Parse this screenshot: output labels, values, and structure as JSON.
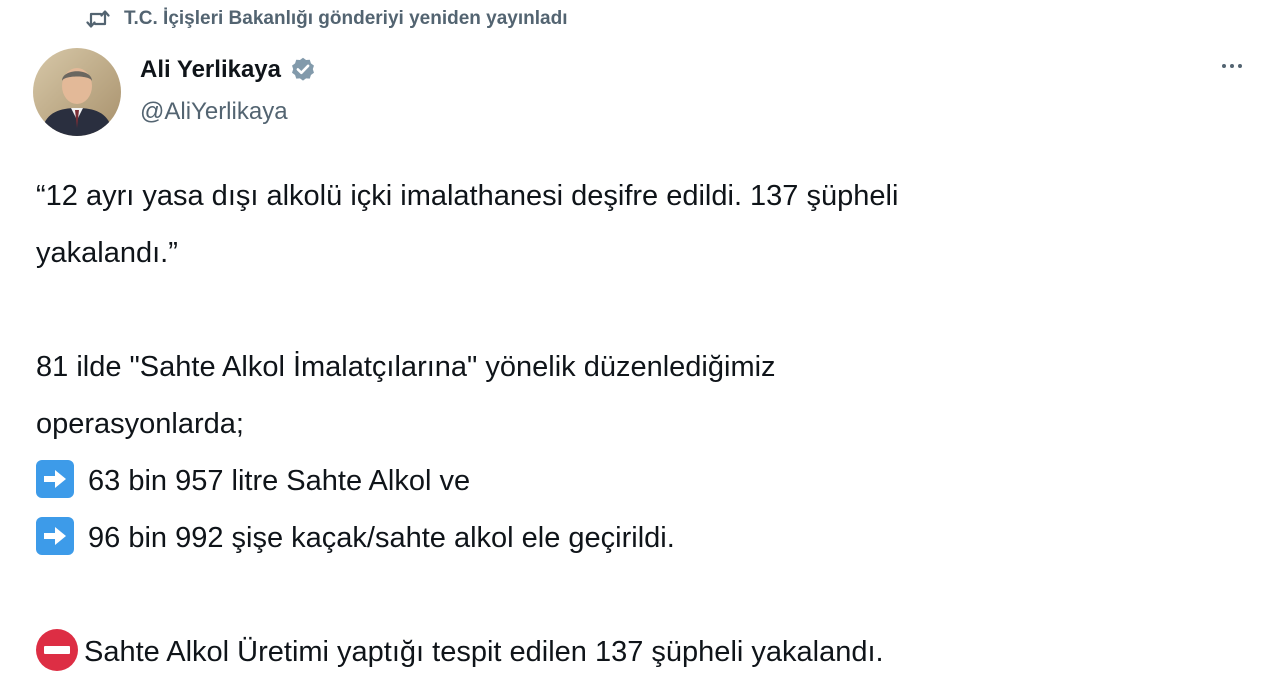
{
  "retweet": {
    "icon": "retweet-icon",
    "text": "T.C. İçişleri Bakanlığı gönderiyi yeniden yayınladı"
  },
  "author": {
    "name": "Ali Yerlikaya",
    "handle": "@AliYerlikaya",
    "verified_icon": "verified-badge-icon",
    "verified_color": "#829aab"
  },
  "tweet": {
    "line1": "“12 ayrı yasa dışı alkolü içki imalathanesi deşifre edildi. 137 şüpheli",
    "line2": "yakalandı.”",
    "line3": "81 ilde \"Sahte Alkol İmalatçılarına\" yönelik düzenlediğimiz",
    "line4": "operasyonlarda;",
    "bullet1": "63 bin 957 litre Sahte Alkol ve",
    "bullet2": "96 bin 992 şişe kaçak/sahte alkol ele geçirildi.",
    "final": "Sahte Alkol Üretimi yaptığı tespit edilen 137 şüpheli yakalandı.",
    "bullet_icon": "right-arrow-emoji-icon",
    "final_icon": "no-entry-emoji-icon"
  },
  "colors": {
    "text": "#0f1419",
    "secondary": "#536471",
    "emoji_blue": "#3d9be9",
    "emoji_red": "#dd2e44"
  }
}
